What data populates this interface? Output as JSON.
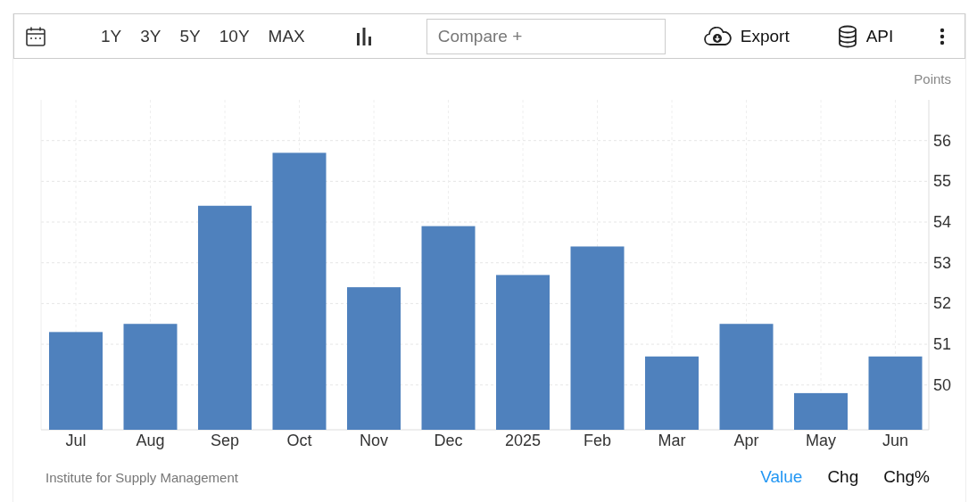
{
  "toolbar": {
    "ranges": [
      {
        "label": "1Y",
        "selected": false
      },
      {
        "label": "3Y",
        "selected": false
      },
      {
        "label": "5Y",
        "selected": false
      },
      {
        "label": "10Y",
        "selected": false
      },
      {
        "label": "MAX",
        "selected": false
      }
    ],
    "compare": {
      "placeholder": "Compare +"
    },
    "actions": [
      {
        "kind": "export",
        "label": "Export"
      },
      {
        "kind": "api",
        "label": "API"
      }
    ]
  },
  "chart": {
    "unit": "Points",
    "chart_data": {
      "type": "bar",
      "categories": [
        "Jul",
        "Aug",
        "Sep",
        "Oct",
        "Nov",
        "Dec",
        "2025",
        "Feb",
        "Mar",
        "Apr",
        "May",
        "Jun"
      ],
      "grid": true,
      "series": [
        {
          "color": "#4f81bd",
          "values": [
            51.3,
            51.5,
            54.4,
            55.7,
            52.4,
            53.9,
            52.7,
            53.4,
            50.7,
            51.5,
            49.8,
            50.7
          ]
        }
      ],
      "ylim": [
        48.9,
        57
      ],
      "yticks": [
        50,
        51,
        52,
        53,
        54,
        55,
        56
      ]
    }
  },
  "footer": {
    "source": "Institute for Supply Management",
    "tabs": [
      {
        "label": "Value",
        "selected": true
      },
      {
        "label": "Chg",
        "selected": false
      },
      {
        "label": "Chg%",
        "selected": false
      }
    ]
  }
}
